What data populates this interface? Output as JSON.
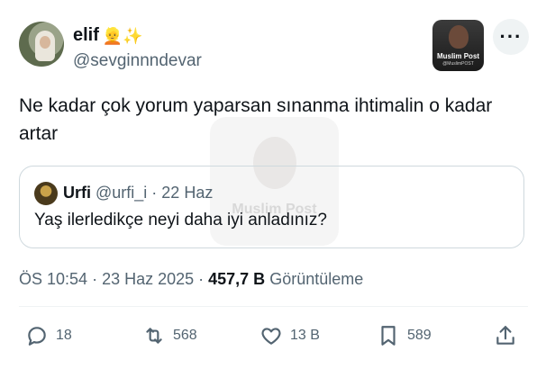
{
  "author": {
    "display_name": "elif",
    "emojis": "👱✨",
    "handle": "@sevginnndevar"
  },
  "badge": {
    "name": "Muslim Post",
    "handle": "@MuslimPOST"
  },
  "more_icon": "···",
  "tweet_text": "Ne kadar çok yorum yaparsan sınanma ihtimalin o kadar artar",
  "watermark_text": "Muslim Post",
  "quote": {
    "name": "Urfi",
    "handle": "@urfi_i",
    "separator": "·",
    "date": "22 Haz",
    "text": "Yaş ilerledikçe neyi daha iyi anladınız?"
  },
  "meta": {
    "time": "ÖS 10:54",
    "sep1": "·",
    "date": "23 Haz 2025",
    "sep2": "·",
    "views": "457,7 B",
    "views_label": "Görüntüleme"
  },
  "actions": {
    "replies": "18",
    "reposts": "568",
    "likes": "13 B",
    "bookmarks": "589"
  },
  "colors": {
    "text": "#0f1419",
    "secondary": "#536471",
    "border": "#cfd9de"
  },
  "icons": [
    "reply-icon",
    "repost-icon",
    "like-icon",
    "bookmark-icon",
    "share-icon",
    "more-icon"
  ]
}
